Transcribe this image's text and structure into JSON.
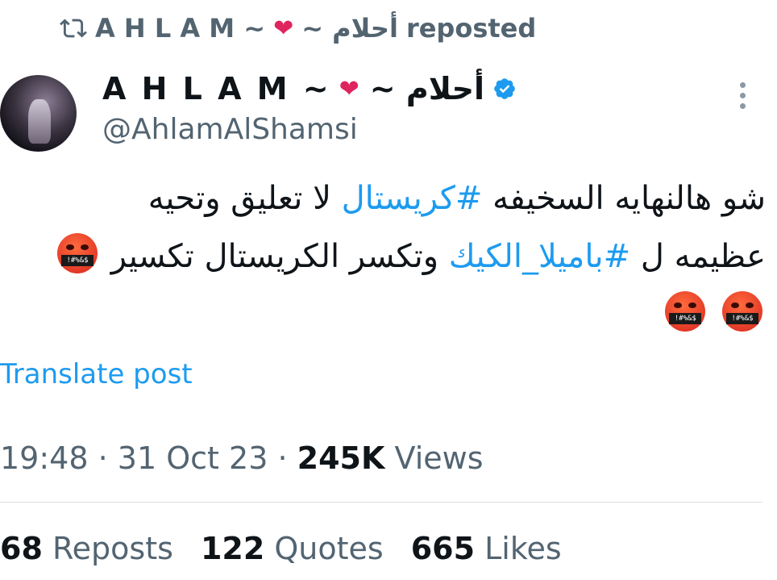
{
  "repost_header": {
    "name_prefix": "A H L A M ~",
    "heart": "❤",
    "name_suffix": "~ أحلام",
    "action": "reposted"
  },
  "author": {
    "name_prefix": "A H L A M ~",
    "heart": "❤",
    "name_suffix": "~ أحلام",
    "handle": "@AhlamAlShamsi",
    "verified_color": "#1d9bf0"
  },
  "tweet": {
    "line1_part1": "شو هالنهايه السخيفه",
    "hashtag1": "#كريستال",
    "line1_part2": "لا تعليق وتحيه",
    "line2_part1": "عظيمه ل",
    "hashtag2": "#باميلا_الكيك",
    "line2_part2": "وتكسر الكريستال تكسير",
    "emoji_text": "!#%&$"
  },
  "translate_label": "Translate post",
  "meta": {
    "time": "19:48",
    "separator": "·",
    "date": "31 Oct 23",
    "views_count": "245K",
    "views_label": "Views"
  },
  "stats": {
    "reposts_count": "68",
    "reposts_label": "Reposts",
    "quotes_count": "122",
    "quotes_label": "Quotes",
    "likes_count": "665",
    "likes_label": "Likes"
  },
  "colors": {
    "accent": "#1d9bf0",
    "secondary_text": "#536471",
    "heart": "#e0245e"
  }
}
